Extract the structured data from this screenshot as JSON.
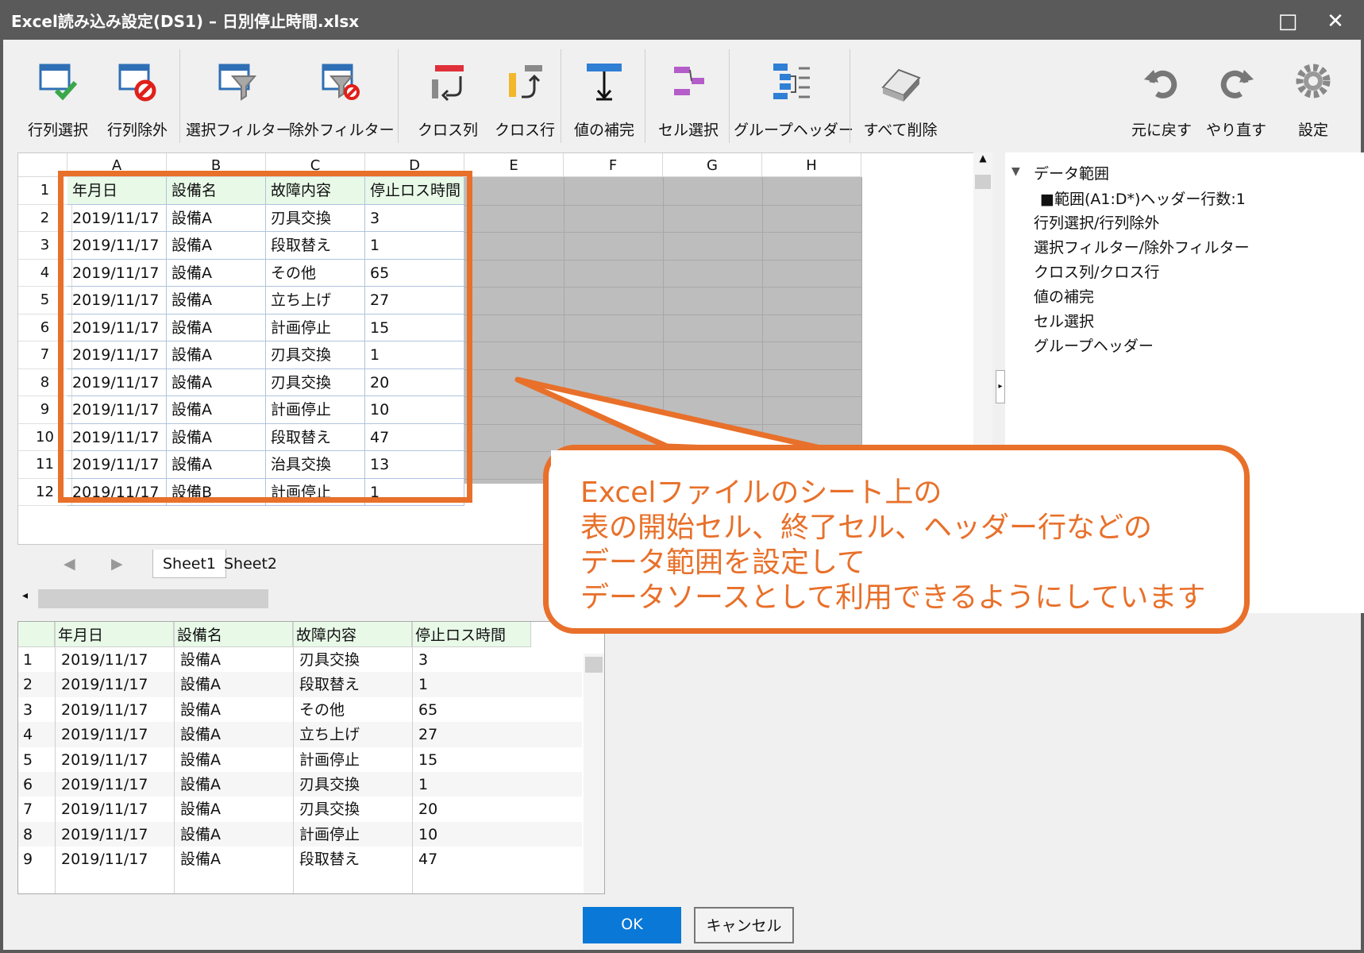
{
  "window": {
    "title": "Excel読み込み設定(DS1) – 日別停止時間.xlsx",
    "maximize_glyph": "□",
    "close_glyph": "✕"
  },
  "toolbar": {
    "row_select": "行列選択",
    "row_exclude": "行列除外",
    "select_filter": "選択フィルター",
    "exclude_filter": "除外フィルター",
    "cross_column": "クロス列",
    "cross_row": "クロス行",
    "value_fill": "値の補完",
    "cell_select": "セル選択",
    "group_header": "グループヘッダー",
    "delete_all": "すべて削除",
    "undo": "元に戻す",
    "redo": "やり直す",
    "settings": "設定"
  },
  "sheet": {
    "columns": [
      "A",
      "B",
      "C",
      "D",
      "E",
      "F",
      "G",
      "H"
    ],
    "row_numbers": [
      "1",
      "2",
      "3",
      "4",
      "5",
      "6",
      "7",
      "8",
      "9",
      "10",
      "11",
      "12"
    ],
    "header": [
      "年月日",
      "設備名",
      "故障内容",
      "停止ロス時間"
    ],
    "rows": [
      [
        "2019/11/17",
        "設備A",
        "刃具交換",
        "3"
      ],
      [
        "2019/11/17",
        "設備A",
        "段取替え",
        "1"
      ],
      [
        "2019/11/17",
        "設備A",
        "その他",
        "65"
      ],
      [
        "2019/11/17",
        "設備A",
        "立ち上げ",
        "27"
      ],
      [
        "2019/11/17",
        "設備A",
        "計画停止",
        "15"
      ],
      [
        "2019/11/17",
        "設備A",
        "刃具交換",
        "1"
      ],
      [
        "2019/11/17",
        "設備A",
        "刃具交換",
        "20"
      ],
      [
        "2019/11/17",
        "設備A",
        "計画停止",
        "10"
      ],
      [
        "2019/11/17",
        "設備A",
        "段取替え",
        "47"
      ],
      [
        "2019/11/17",
        "設備A",
        "治具交換",
        "13"
      ],
      [
        "2019/11/17",
        "設備B",
        "計画停止",
        "1"
      ]
    ],
    "tabs": [
      "Sheet1",
      "Sheet2"
    ],
    "prev_glyph": "◀",
    "next_glyph": "▶",
    "up_glyph": "▲",
    "left_glyph": "◂"
  },
  "tree": {
    "root": "データ範囲",
    "expander": "▼",
    "children": [
      "■範囲(A1:D*)ヘッダー行数:1",
      "行列選択/行列除外",
      "選択フィルター/除外フィルター",
      "クロス列/クロス行",
      "値の補完",
      "セル選択",
      "グループヘッダー"
    ],
    "splitter_glyph": "▸"
  },
  "preview": {
    "header": [
      "年月日",
      "設備名",
      "故障内容",
      "停止ロス時間"
    ],
    "row_numbers": [
      "1",
      "2",
      "3",
      "4",
      "5",
      "6",
      "7",
      "8",
      "9"
    ],
    "rows": [
      [
        "2019/11/17",
        "設備A",
        "刃具交換",
        "3"
      ],
      [
        "2019/11/17",
        "設備A",
        "段取替え",
        "1"
      ],
      [
        "2019/11/17",
        "設備A",
        "その他",
        "65"
      ],
      [
        "2019/11/17",
        "設備A",
        "立ち上げ",
        "27"
      ],
      [
        "2019/11/17",
        "設備A",
        "計画停止",
        "15"
      ],
      [
        "2019/11/17",
        "設備A",
        "刃具交換",
        "1"
      ],
      [
        "2019/11/17",
        "設備A",
        "刃具交換",
        "20"
      ],
      [
        "2019/11/17",
        "設備A",
        "計画停止",
        "10"
      ],
      [
        "2019/11/17",
        "設備A",
        "段取替え",
        "47"
      ]
    ]
  },
  "buttons": {
    "ok": "OK",
    "cancel": "キャンセル"
  },
  "callout": {
    "lines": [
      "Excelファイルのシート上の",
      "表の開始セル、終了セル、ヘッダー行などの",
      "データ範囲を設定して",
      "データソースとして利用できるようにしています"
    ]
  },
  "colors": {
    "accent": "#e8702a",
    "ok_button": "#0a78d7",
    "header_fill": "#e8f9e8",
    "unused_cells": "#bdbdbd"
  }
}
